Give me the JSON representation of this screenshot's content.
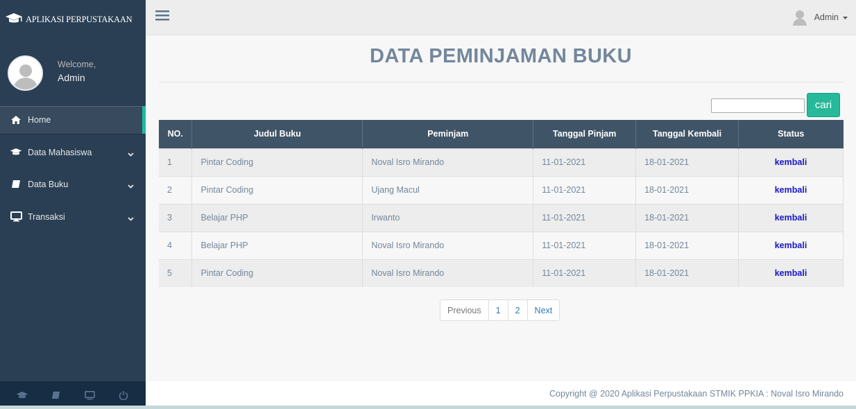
{
  "app": {
    "title": "APLIKASI PERPUSTAKAAN"
  },
  "profile": {
    "welcome": "Welcome,",
    "name": "Admin"
  },
  "sidebar": {
    "items": [
      {
        "label": "Home",
        "icon": "home-icon"
      },
      {
        "label": "Data Mahasiswa",
        "icon": "graduation-cap-icon"
      },
      {
        "label": "Data Buku",
        "icon": "book-icon"
      },
      {
        "label": "Transaksi",
        "icon": "desktop-icon"
      }
    ],
    "footer_icons": [
      "graduation-cap-icon",
      "book-icon",
      "desktop-icon",
      "power-icon"
    ]
  },
  "topnav": {
    "user": "Admin"
  },
  "page": {
    "title": "DATA PEMINJAMAN BUKU"
  },
  "search": {
    "value": "",
    "button": "cari"
  },
  "table": {
    "headers": [
      "NO.",
      "Judul Buku",
      "Peminjam",
      "Tanggal Pinjam",
      "Tanggal Kembali",
      "Status"
    ],
    "rows": [
      [
        "1",
        "Pintar Coding",
        "Noval Isro Mirando",
        "11-01-2021",
        "18-01-2021",
        "kembali"
      ],
      [
        "2",
        "Pintar Coding",
        "Ujang Macul",
        "11-01-2021",
        "18-01-2021",
        "kembali"
      ],
      [
        "3",
        "Belajar PHP",
        "Irwanto",
        "11-01-2021",
        "18-01-2021",
        "kembali"
      ],
      [
        "4",
        "Belajar PHP",
        "Noval Isro Mirando",
        "11-01-2021",
        "18-01-2021",
        "kembali"
      ],
      [
        "5",
        "Pintar Coding",
        "Noval Isro Mirando",
        "11-01-2021",
        "18-01-2021",
        "kembali"
      ]
    ]
  },
  "pagination": {
    "previous": "Previous",
    "pages": [
      "1",
      "2"
    ],
    "next": "Next"
  },
  "footer": {
    "copyright": "Copyright @ 2020 Aplikasi Perpustakaan STMIK PPKIA : Noval Isro Mirando"
  },
  "colors": {
    "sidebar": "#2a3f54",
    "accent": "#1abb9c",
    "button": "#26b99a",
    "table_header": "#405467",
    "status_link": "#1717c7"
  }
}
